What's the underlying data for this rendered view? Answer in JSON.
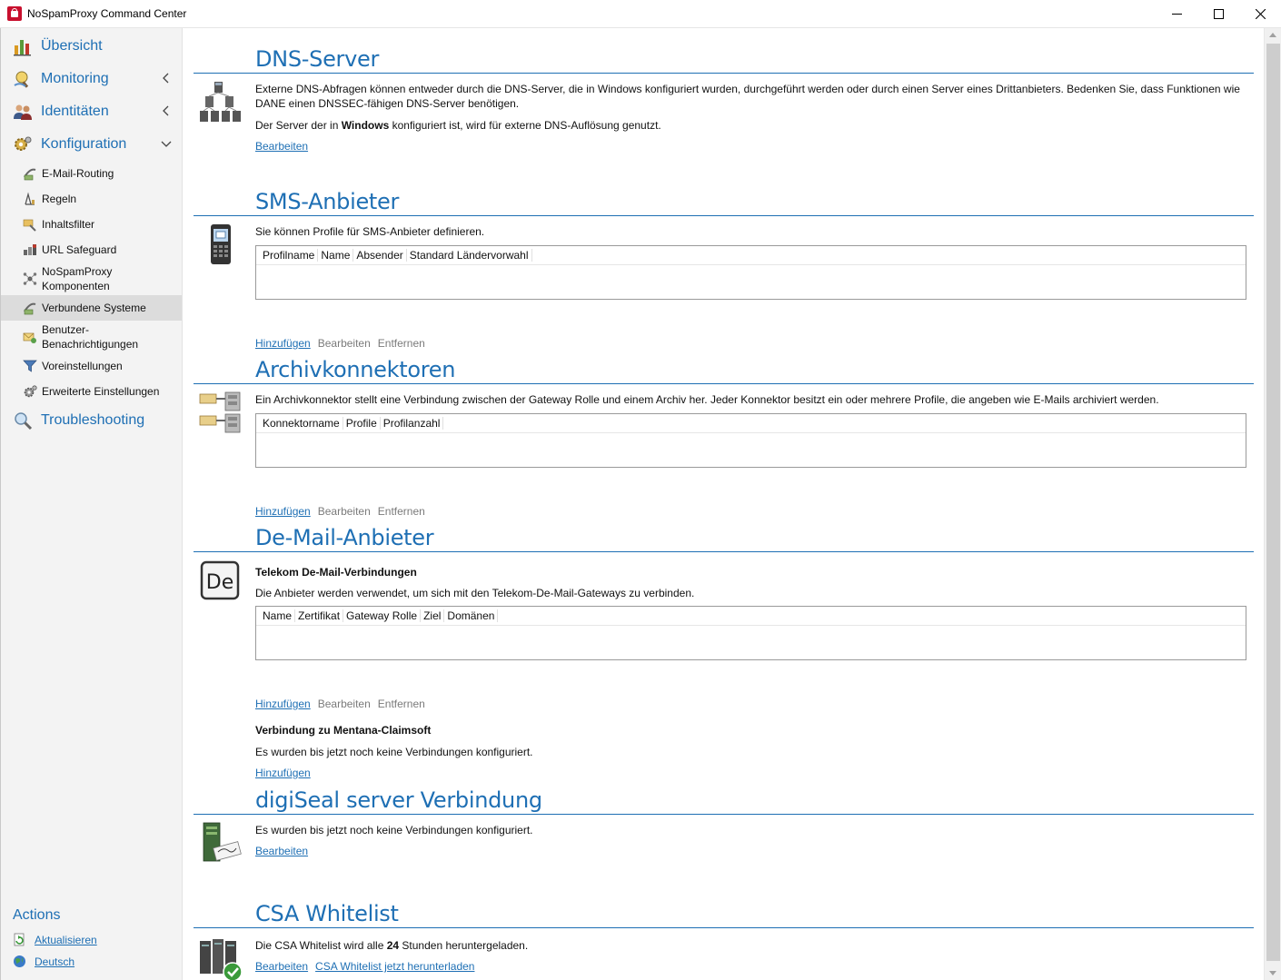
{
  "window": {
    "title": "NoSpamProxy Command Center",
    "controls": [
      "minimize",
      "maximize",
      "close"
    ]
  },
  "sidebar": {
    "main_items": [
      {
        "label": "Übersicht",
        "icon": "chart-icon",
        "chevron": ""
      },
      {
        "label": "Monitoring",
        "icon": "monitoring-icon",
        "chevron": "left"
      },
      {
        "label": "Identitäten",
        "icon": "users-icon",
        "chevron": "left"
      },
      {
        "label": "Konfiguration",
        "icon": "gear-icon",
        "chevron": "down"
      }
    ],
    "sub_items": [
      {
        "label": "E-Mail-Routing",
        "icon": "routing-icon"
      },
      {
        "label": "Regeln",
        "icon": "rules-icon"
      },
      {
        "label": "Inhaltsfilter",
        "icon": "content-filter-icon"
      },
      {
        "label": "URL Safeguard",
        "icon": "url-safeguard-icon"
      },
      {
        "label": "NoSpamProxy Komponenten",
        "line1": "NoSpamProxy",
        "line2": "Komponenten",
        "icon": "components-icon"
      },
      {
        "label": "Verbundene Systeme",
        "icon": "connected-systems-icon",
        "active": true
      },
      {
        "label": "Benutzer-Benachrichtigungen",
        "line1": "Benutzer-",
        "line2": "Benachrichtigungen",
        "icon": "notifications-icon"
      },
      {
        "label": "Voreinstellungen",
        "icon": "filter-funnel-icon"
      },
      {
        "label": "Erweiterte Einstellungen",
        "icon": "advanced-settings-icon"
      }
    ],
    "troubleshooting": {
      "label": "Troubleshooting",
      "icon": "magnifier-icon"
    },
    "actions": {
      "title": "Actions",
      "items": [
        {
          "label": "Aktualisieren",
          "icon": "refresh-icon"
        },
        {
          "label": "Deutsch",
          "icon": "globe-icon"
        }
      ]
    }
  },
  "sections": {
    "dns": {
      "title": "DNS-Server",
      "description": "Externe DNS-Abfragen können entweder durch die DNS-Server, die in Windows konfiguriert wurden, durchgeführt werden oder durch einen Server eines Drittanbieters. Bedenken Sie, dass Funktionen wie DANE einen DNSSEC-fähigen DNS-Server benötigen.",
      "status_prefix": "Der Server der in ",
      "status_bold": "Windows",
      "status_suffix": " konfiguriert ist, wird für externe DNS-Auflösung genutzt.",
      "edit": "Bearbeiten"
    },
    "sms": {
      "title": "SMS-Anbieter",
      "description": "Sie können Profile für SMS-Anbieter definieren.",
      "columns": [
        "Profilname",
        "Name",
        "Absender",
        "Standard Ländervorwahl"
      ],
      "add": "Hinzufügen",
      "edit": "Bearbeiten",
      "remove": "Entfernen"
    },
    "archive": {
      "title": "Archivkonnektoren",
      "description": "Ein Archivkonnektor stellt eine Verbindung zwischen der Gateway Rolle und einem Archiv her. Jeder Konnektor besitzt ein oder mehrere Profile, die angeben wie E-Mails archiviert werden.",
      "columns": [
        "Konnektorname",
        "Profile",
        "Profilanzahl"
      ],
      "add": "Hinzufügen",
      "edit": "Bearbeiten",
      "remove": "Entfernen"
    },
    "demail": {
      "title": "De-Mail-Anbieter",
      "icon_text": "De",
      "telekom_heading": "Telekom De-Mail-Verbindungen",
      "telekom_description": "Die Anbieter werden verwendet, um sich mit den Telekom-De-Mail-Gateways zu verbinden.",
      "columns": [
        "Name",
        "Zertifikat",
        "Gateway Rolle",
        "Ziel",
        "Domänen"
      ],
      "add": "Hinzufügen",
      "edit": "Bearbeiten",
      "remove": "Entfernen",
      "mentana_heading": "Verbindung zu Mentana-Claimsoft",
      "mentana_status": "Es wurden bis jetzt noch keine Verbindungen konfiguriert.",
      "mentana_add": "Hinzufügen"
    },
    "digiseal": {
      "title": "digiSeal server Verbindung",
      "status": "Es wurden bis jetzt noch keine Verbindungen konfiguriert.",
      "edit": "Bearbeiten"
    },
    "csa": {
      "title": "CSA Whitelist",
      "status_prefix": "Die CSA Whitelist wird alle ",
      "status_bold": "24",
      "status_suffix": " Stunden heruntergeladen.",
      "edit": "Bearbeiten",
      "download": "CSA Whitelist jetzt herunterladen"
    }
  }
}
